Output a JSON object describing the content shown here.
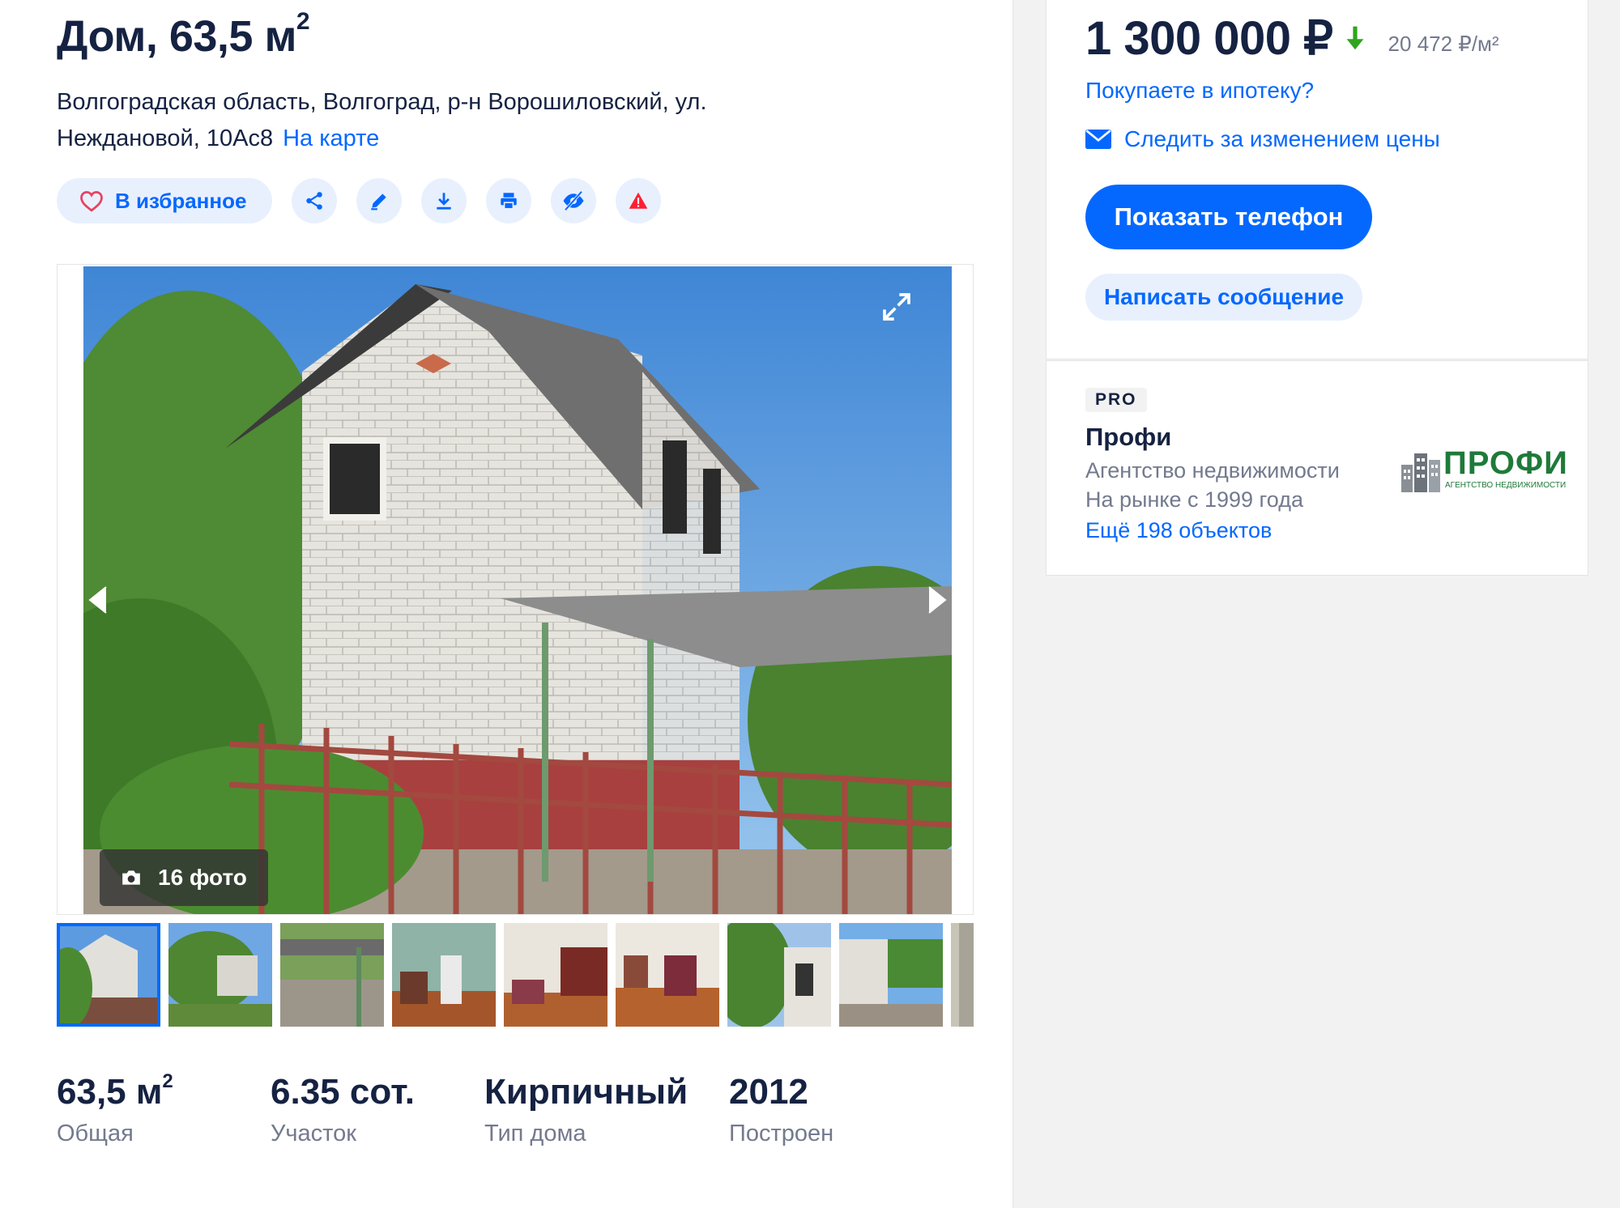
{
  "listing": {
    "title": "Дом, 63,5 м",
    "title_sup": "2",
    "address": "Волгоградская область, Волгоград, р-н Ворошиловский, ул. Неждановой, 10Ас8",
    "map_link": "На карте"
  },
  "actions": {
    "favorite_label": "В избранное",
    "icons": [
      "share-icon",
      "edit-icon",
      "download-icon",
      "print-icon",
      "hide-icon",
      "complaint-icon"
    ]
  },
  "gallery": {
    "photo_count": "16 фото",
    "thumbnails": 9
  },
  "facts": [
    {
      "value": "63,5 м",
      "sup": "2",
      "label": "Общая"
    },
    {
      "value": "6.35 сот.",
      "sup": "",
      "label": "Участок"
    },
    {
      "value": "Кирпичный",
      "sup": "",
      "label": "Тип дома"
    },
    {
      "value": "2012",
      "sup": "",
      "label": "Построен"
    }
  ],
  "price": {
    "value": "1 300 000 ₽",
    "per_sqm": "20 472 ₽/м²",
    "trend": "down",
    "trend_color": "#2fa51d",
    "mortgage_link": "Покупаете в ипотеку?",
    "watch_link": "Следить за изменением цены",
    "show_phone": "Показать телефон",
    "write_message": "Написать сообщение"
  },
  "agent": {
    "badge": "PRO",
    "name": "Профи",
    "type": "Агентство недвижимости",
    "since": "На рынке с 1999 года",
    "more": "Ещё 198 объектов",
    "logo_text": "ПРОФИ",
    "logo_sub": "АГЕНТСТВО НЕДВИЖИМОСТИ"
  },
  "colors": {
    "accent": "#0468ff",
    "text": "#152242",
    "muted": "#737a8e",
    "accent_light": "#e8f0fe"
  }
}
